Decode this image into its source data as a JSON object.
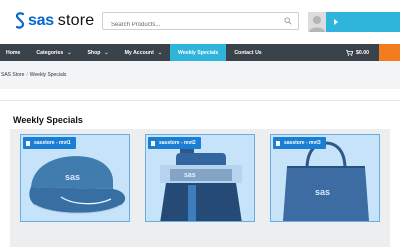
{
  "header": {
    "logo_sas": "sas",
    "logo_store": "store",
    "search_placeholder": "Search Products..."
  },
  "nav": {
    "items": [
      {
        "label": "Home"
      },
      {
        "label": "Categories"
      },
      {
        "label": "Shop"
      },
      {
        "label": "My Account"
      },
      {
        "label": "Weekly Specials"
      },
      {
        "label": "Contact Us"
      }
    ],
    "cart_total": "$0.00"
  },
  "breadcrumb": {
    "root": "SAS Store",
    "separator": "/",
    "current": "Weekly Specials"
  },
  "main": {
    "heading": "Weekly Specials",
    "products": [
      {
        "label": "sasstore - mvt1"
      },
      {
        "label": "sasstore - mvt2"
      },
      {
        "label": "sasstore - mvt3"
      }
    ]
  },
  "colors": {
    "brand_blue": "#0766d1",
    "nav_bg": "#3b434a",
    "accent_cyan": "#2fb5dc",
    "accent_orange": "#f37b20"
  }
}
